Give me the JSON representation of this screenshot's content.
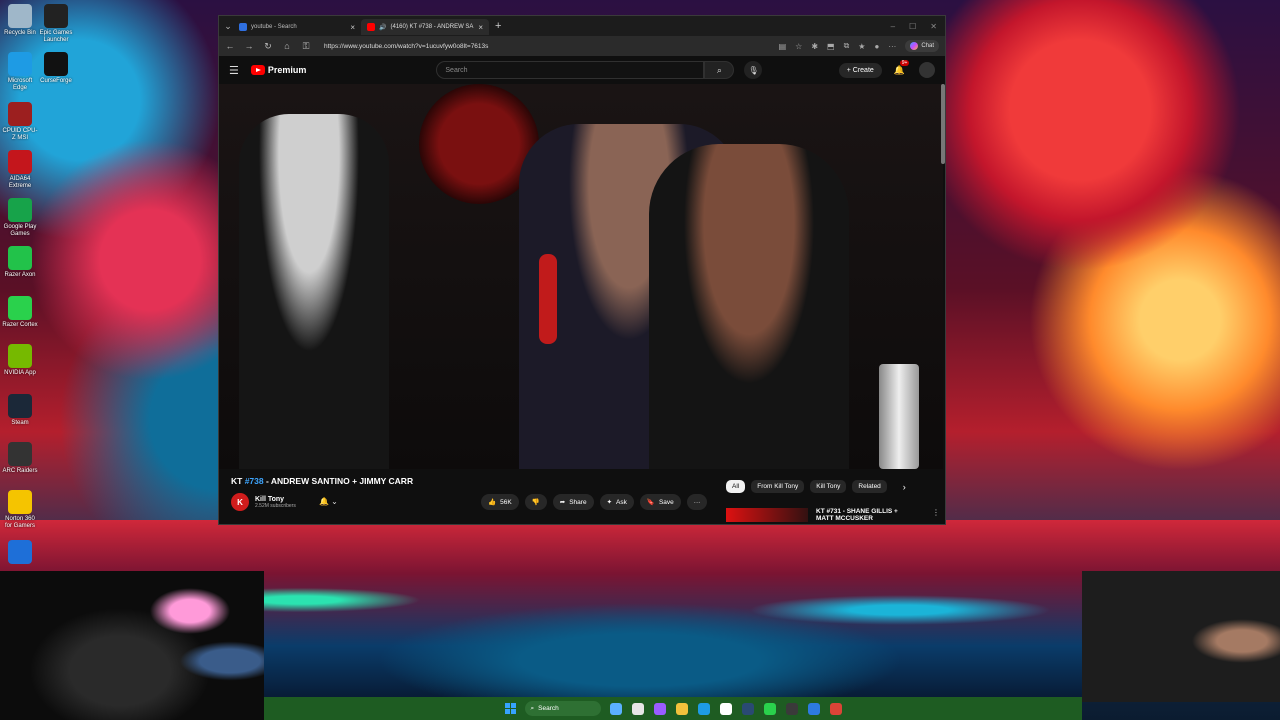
{
  "desktop": {
    "icons": [
      {
        "label": "Recycle Bin",
        "color": "#9fb7c9"
      },
      {
        "label": "Epic Games Launcher",
        "color": "#222222"
      },
      {
        "label": "Microsoft Edge",
        "color": "#1e9be4"
      },
      {
        "label": "CurseForge",
        "color": "#111111"
      },
      {
        "label": "CPUID CPU-Z MSI",
        "color": "#9c1f1f"
      },
      {
        "label": "AIDA64 Extreme",
        "color": "#c4161c"
      },
      {
        "label": "Google Play Games",
        "color": "#17a34a"
      },
      {
        "label": "Razer Axon",
        "color": "#22c24a"
      },
      {
        "label": "Razer Cortex",
        "color": "#2ad14c"
      },
      {
        "label": "NVIDIA App",
        "color": "#76b900"
      },
      {
        "label": "Steam",
        "color": "#1b2838"
      },
      {
        "label": "ARC Raiders",
        "color": "#333333"
      },
      {
        "label": "Norton 360 for Gamers",
        "color": "#f5c400"
      },
      {
        "label": "",
        "color": "#1e6fd8"
      }
    ]
  },
  "browser": {
    "tabs": [
      {
        "title": "youtube - Search",
        "active": false
      },
      {
        "title": "(4160) KT #738 - ANDREW SA",
        "active": true
      }
    ],
    "new_tab": "+",
    "window_controls": [
      "–",
      "☐",
      "✕"
    ],
    "address": "https://www.youtube.com/watch?v=1ucuvfyw0o8lt=7613s",
    "copilot_label": "Chat"
  },
  "youtube": {
    "logo_text": "Premium",
    "search_placeholder": "Search",
    "create_label": "Create",
    "notif_badge": "9+",
    "video": {
      "title_prefix": "KT ",
      "title_tag": "#738",
      "title_rest": " - ANDREW SANTINO + JIMMY CARR",
      "channel": "Kill Tony",
      "channel_avatar_letter": "K",
      "subscribers": "2.52M subscribers",
      "like_count": "56K",
      "share_label": "Share",
      "ask_label": "Ask",
      "save_label": "Save",
      "more_label": "···"
    },
    "chips": [
      "All",
      "From Kill Tony",
      "Kill Tony",
      "Related"
    ],
    "recommendation": {
      "title": "KT #731 - SHANE GILLIS + MATT MCCUSKER"
    }
  },
  "taskbar": {
    "search_label": "Search",
    "icons": [
      {
        "name": "widgets-icon",
        "color": "#5bb0ff"
      },
      {
        "name": "task-view-icon",
        "color": "#e6e6e6"
      },
      {
        "name": "app-icon-1",
        "color": "#9a5cff"
      },
      {
        "name": "file-explorer-icon",
        "color": "#f2c13c"
      },
      {
        "name": "edge-icon",
        "color": "#1e9be4"
      },
      {
        "name": "store-icon",
        "color": "#ffffff"
      },
      {
        "name": "steam-icon",
        "color": "#2a4a73"
      },
      {
        "name": "razer-icon",
        "color": "#2ad14c"
      },
      {
        "name": "obs-icon",
        "color": "#3a3a3a"
      },
      {
        "name": "app-icon-2",
        "color": "#2d7ae0"
      },
      {
        "name": "chrome-icon",
        "color": "#db4437"
      }
    ]
  }
}
